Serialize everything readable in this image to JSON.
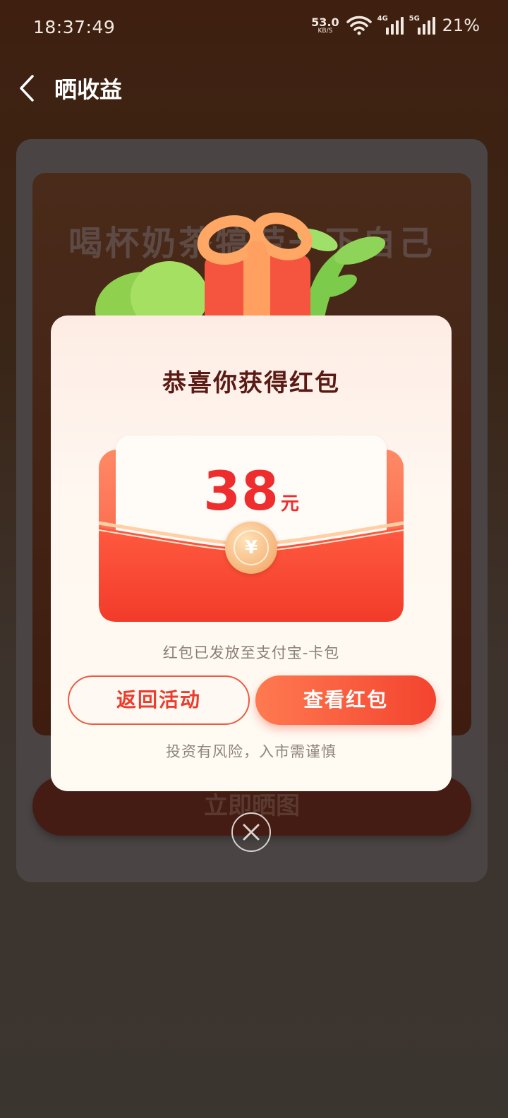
{
  "status_bar": {
    "time": "18:37:49",
    "net_speed": "53.0",
    "net_speed_unit": "KB/S",
    "signal_4g": "4G",
    "signal_5g": "5G",
    "battery": "21%"
  },
  "header": {
    "title": "晒收益"
  },
  "background_card": {
    "slogan": "喝杯奶茶犒劳一下自己",
    "share_button": "立即晒图"
  },
  "modal": {
    "title": "恭喜你获得红包",
    "amount": "38",
    "amount_unit": "元",
    "seal_symbol": "¥",
    "note": "红包已发放至支付宝-卡包",
    "return_button": "返回活动",
    "view_button": "查看红包",
    "risk_note": "投资有风险，入市需谨慎"
  },
  "colors": {
    "accent_red": "#ee2e2e",
    "button_gradient_start": "#ff7a50",
    "button_gradient_end": "#f3432f",
    "title_brown": "#5a1a14"
  }
}
